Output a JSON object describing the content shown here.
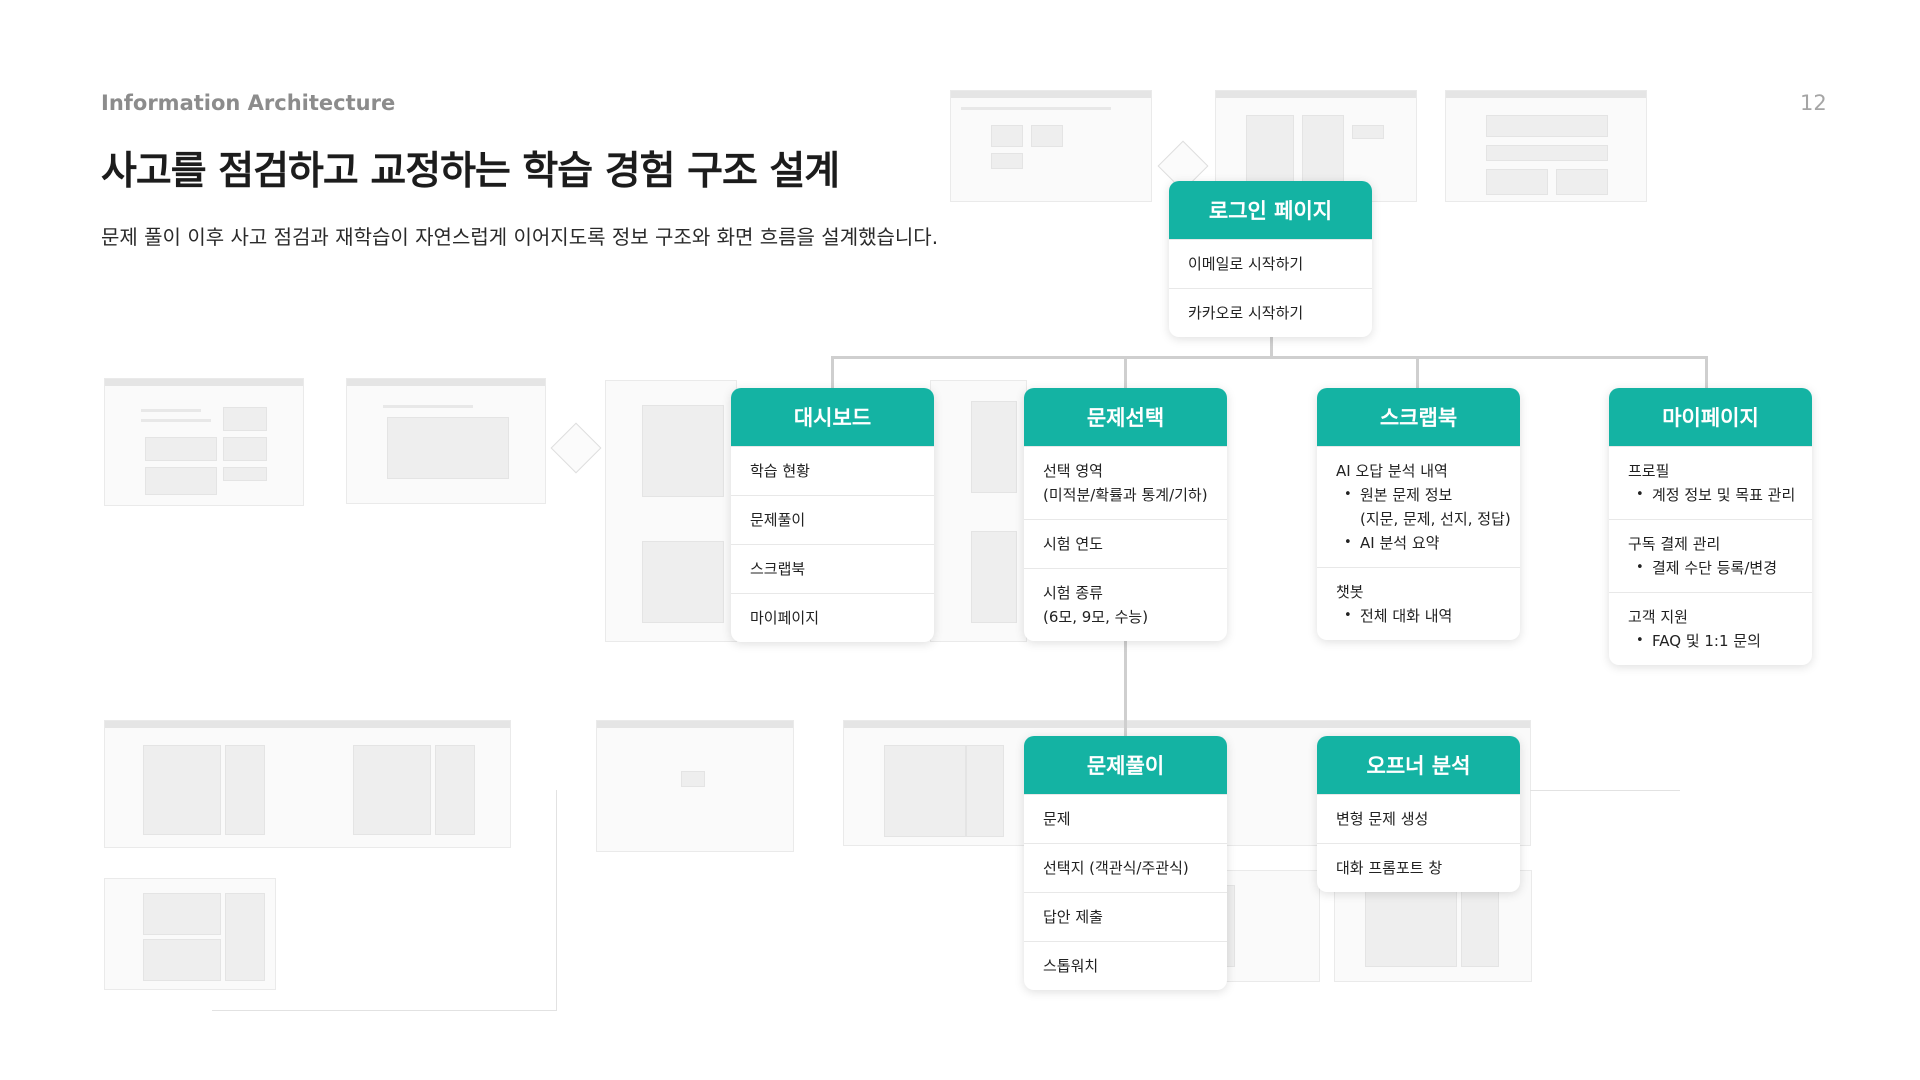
{
  "header": {
    "section_label": "Information Architecture",
    "page_number": "12"
  },
  "title": "사고를 점검하고 교정하는 학습 경험 구조 설계",
  "subtitle": "문제 풀이 이후 사고 점검과 재학습이 자연스럽게 이어지도록 정보 구조와 화면 흐름을 설계했습니다.",
  "accent_color": "#14b3a3",
  "nodes": {
    "login": {
      "title": "로그인 페이지",
      "items": [
        "이메일로 시작하기",
        "카카오로 시작하기"
      ]
    },
    "dashboard": {
      "title": "대시보드",
      "items": [
        "학습 현황",
        "문제풀이",
        "스크랩북",
        "마이페이지"
      ]
    },
    "problem_select": {
      "title": "문제선택",
      "items": [
        {
          "label": "선택 영역",
          "line2": "(미적분/확률과 통계/기하)"
        },
        {
          "label": "시험 연도"
        },
        {
          "label": "시험 종류",
          "line2": "(6모, 9모, 수능)"
        }
      ]
    },
    "scrapbook": {
      "title": "스크랩북",
      "items": [
        {
          "label": "AI 오답 분석 내역",
          "bullets": [
            "원본 문제 정보",
            "AI 분석 요약"
          ],
          "bullet0_cont": "(지문, 문제, 선지, 정답)"
        },
        {
          "label": "챗봇",
          "bullets": [
            "전체 대화 내역"
          ]
        }
      ]
    },
    "mypage": {
      "title": "마이페이지",
      "items": [
        {
          "label": "프로필",
          "bullets": [
            "계정 정보 및 목표 관리"
          ]
        },
        {
          "label": "구독 결제 관리",
          "bullets": [
            "결제 수단 등록/변경"
          ]
        },
        {
          "label": "고객 지원",
          "bullets": [
            "FAQ 및 1:1 문의"
          ]
        }
      ]
    },
    "problem_solve": {
      "title": "문제풀이",
      "items": [
        "문제",
        "선택지 (객관식/주관식)",
        "답안 제출",
        "스톱워치"
      ]
    },
    "opener_analysis": {
      "title": "오프너 분석",
      "items": [
        "변형 문제 생성",
        "대화 프롬포트 창"
      ]
    }
  }
}
